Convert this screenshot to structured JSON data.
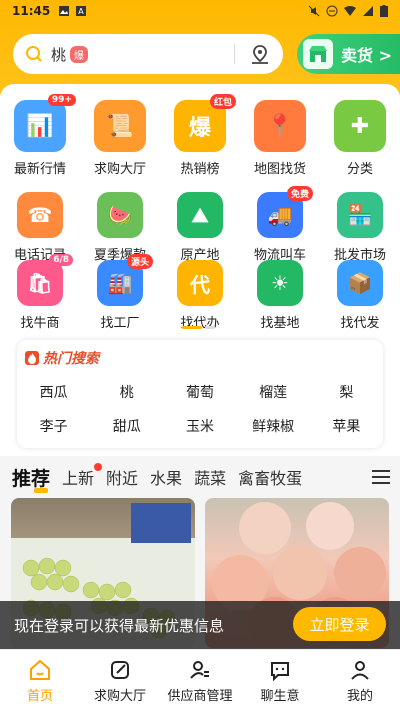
{
  "status_bar": {
    "time": "11:45"
  },
  "search": {
    "text": "桃",
    "tag": "爆"
  },
  "sell_button": {
    "label": "卖货 >"
  },
  "grid": [
    [
      {
        "label": "最新行情",
        "badge": "99+",
        "color": "#4aa3ff",
        "glyph": "📊"
      },
      {
        "label": "求购大厅",
        "badge": "",
        "color": "#ff9a2e",
        "glyph": "📜"
      },
      {
        "label": "热销榜",
        "badge": "红包",
        "color": "#ffb400",
        "glyph": "爆"
      },
      {
        "label": "地图找货",
        "badge": "",
        "color": "#ff7a3c",
        "glyph": "📍"
      },
      {
        "label": "分类",
        "badge": "",
        "color": "#7ac943",
        "glyph": "✚"
      }
    ],
    [
      {
        "label": "电话记录",
        "badge": "",
        "color": "#ff8a3d",
        "glyph": "☎"
      },
      {
        "label": "夏季爆款",
        "badge": "",
        "color": "#6bbf59",
        "glyph": "🍉"
      },
      {
        "label": "原产地",
        "badge": "",
        "color": "#22b864",
        "glyph": "⛰"
      },
      {
        "label": "物流叫车",
        "badge": "免费",
        "color": "#3a7bff",
        "glyph": "🚚"
      },
      {
        "label": "批发市场",
        "badge": "",
        "color": "#35c28a",
        "glyph": "🏪"
      }
    ],
    [
      {
        "label": "找牛商",
        "badge": "6/8",
        "color": "#ff5a8c",
        "glyph": "🛍"
      },
      {
        "label": "找工厂",
        "badge": "源头",
        "color": "#3a8bff",
        "glyph": "🏭"
      },
      {
        "label": "找代办",
        "badge": "",
        "color": "#ffb400",
        "glyph": "代"
      },
      {
        "label": "找基地",
        "badge": "",
        "color": "#22b864",
        "glyph": "☀"
      },
      {
        "label": "找代发",
        "badge": "",
        "color": "#3aa0ff",
        "glyph": "📦"
      }
    ]
  ],
  "hot_search": {
    "title": "热门搜索",
    "items": [
      "西瓜",
      "桃",
      "葡萄",
      "榴莲",
      "梨",
      "李子",
      "甜瓜",
      "玉米",
      "鲜辣椒",
      "苹果"
    ]
  },
  "tabs": [
    "推荐",
    "上新",
    "附近",
    "水果",
    "蔬菜",
    "禽畜牧蛋"
  ],
  "login_bar": {
    "text": "现在登录可以获得最新优惠信息",
    "button": "立即登录"
  },
  "bottom_nav": [
    {
      "label": "首页",
      "icon": "home-icon",
      "active": true
    },
    {
      "label": "求购大厅",
      "icon": "edit-icon",
      "active": false
    },
    {
      "label": "供应商管理",
      "icon": "supplier-icon",
      "active": false
    },
    {
      "label": "聊生意",
      "icon": "chat-icon",
      "active": false
    },
    {
      "label": "我的",
      "icon": "user-icon",
      "active": false
    }
  ],
  "colors": {
    "brand": "#ffb800",
    "accent_green": "#22b864",
    "active_nav": "#ff9f00"
  }
}
